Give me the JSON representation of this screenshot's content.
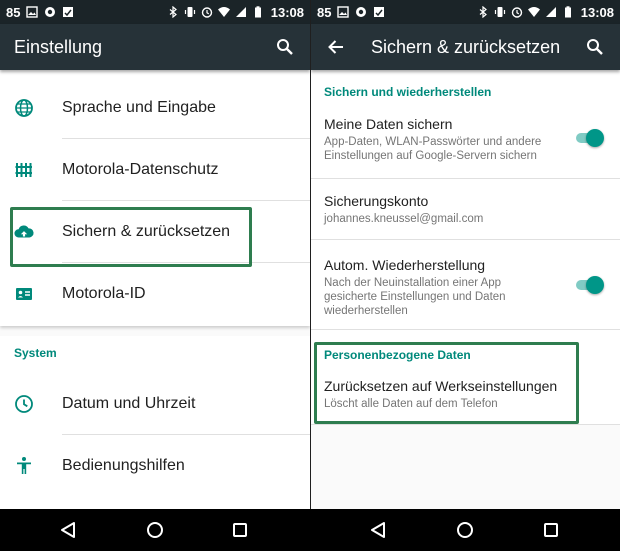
{
  "status_bar": {
    "battery_level": "85",
    "time": "13:08"
  },
  "left_screen": {
    "title": "Einstellung",
    "items": [
      {
        "label": "Sprache und Eingabe",
        "icon": "globe-icon"
      },
      {
        "label": "Motorola-Datenschutz",
        "icon": "fence-icon"
      },
      {
        "label": "Sichern & zurücksetzen",
        "icon": "cloud-upload-icon"
      },
      {
        "label": "Motorola-ID",
        "icon": "id-card-icon"
      }
    ],
    "system_section": "System",
    "system_items": [
      {
        "label": "Datum und Uhrzeit",
        "icon": "clock-icon"
      },
      {
        "label": "Bedienungshilfen",
        "icon": "accessibility-icon"
      }
    ]
  },
  "right_screen": {
    "title": "Sichern & zurücksetzen",
    "section_backup": "Sichern und wiederherstellen",
    "backup": {
      "title": "Meine Daten sichern",
      "subtitle": "App-Daten, WLAN-Passwörter und andere Einstellungen auf Google-Servern sichern",
      "enabled": true
    },
    "account": {
      "title": "Sicherungskonto",
      "subtitle": "johannes.kneussel@gmail.com"
    },
    "restore": {
      "title": "Autom. Wiederherstellung",
      "subtitle": "Nach der Neuinstallation einer App gesicherte Einstellungen und Daten wiederherstellen",
      "enabled": true
    },
    "section_personal": "Personenbezogene Daten",
    "factory_reset": {
      "title": "Zurücksetzen auf Werkseinstellungen",
      "subtitle": "Löscht alle Daten auf dem Telefon"
    }
  },
  "colors": {
    "accent": "#009688",
    "section": "#00897b",
    "appbar": "#263238",
    "highlight": "#2e7d4f"
  }
}
